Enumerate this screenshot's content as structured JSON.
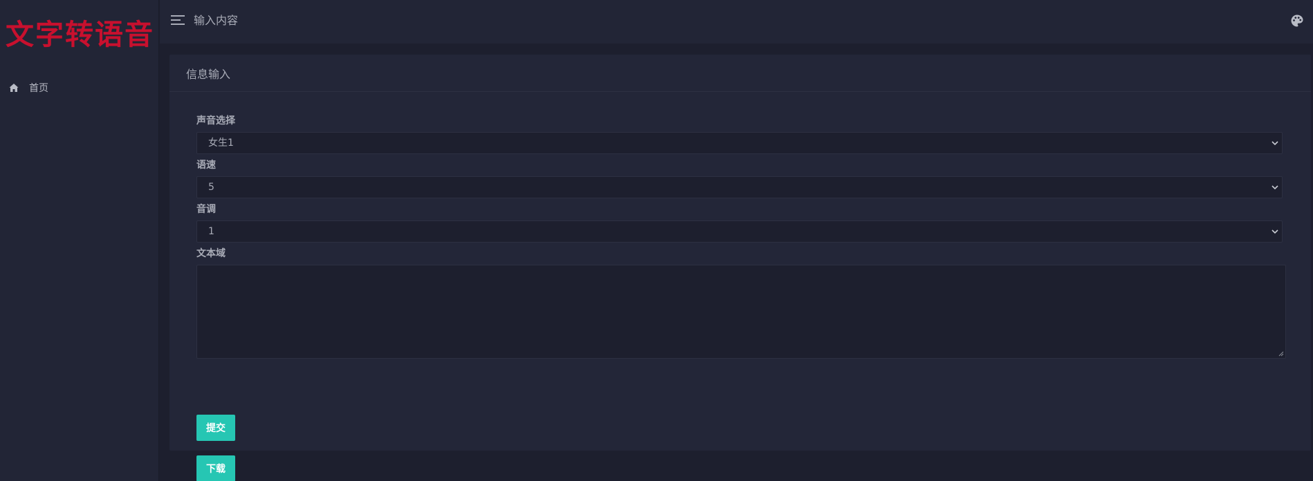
{
  "app": {
    "logo_text": "文字转语音"
  },
  "sidebar": {
    "items": [
      {
        "label": "首页",
        "icon": "home-icon"
      }
    ]
  },
  "topbar": {
    "title": "输入内容",
    "menu_icon": "menu-icon",
    "theme_icon": "palette-icon"
  },
  "card": {
    "title": "信息输入"
  },
  "form": {
    "voice": {
      "label": "声音选择",
      "value": "女生1"
    },
    "speed": {
      "label": "语速",
      "value": "5"
    },
    "pitch": {
      "label": "音调",
      "value": "1"
    },
    "text": {
      "label": "文本域",
      "value": ""
    },
    "submit_label": "提交",
    "download_label": "下载"
  },
  "colors": {
    "background": "#1d1f2e",
    "panel": "#232638",
    "sidebar": "#222536",
    "accent": "#26c6b3",
    "logo": "#c8102e"
  }
}
